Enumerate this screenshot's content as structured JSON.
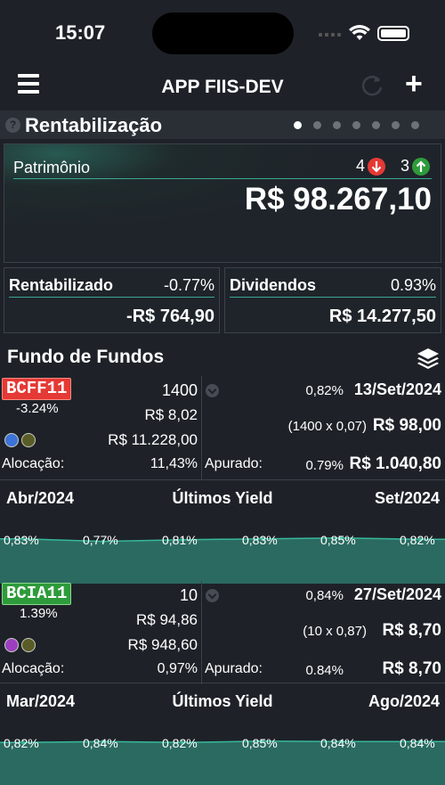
{
  "status": {
    "time": "15:07"
  },
  "nav": {
    "title": "APP FIIS-DEV",
    "menu_icon": "hamburger-menu-icon",
    "refresh_icon": "refresh-icon",
    "add_icon": "plus-icon"
  },
  "section": {
    "title": "Rentabilização",
    "pages": 7,
    "active_page": 0
  },
  "patrimonio": {
    "label": "Patrimônio",
    "down_count": "4",
    "up_count": "3",
    "value": "R$ 98.267,10"
  },
  "rentabilizado": {
    "label": "Rentabilizado",
    "pct": "-0.77%",
    "value": "-R$ 764,90"
  },
  "dividendos": {
    "label": "Dividendos",
    "pct": "0.93%",
    "value": "R$ 14.277,50"
  },
  "fof": {
    "title": "Fundo de Fundos",
    "icon": "layers-icon"
  },
  "funds": [
    {
      "ticker": "BCFF11",
      "ticker_color": "red",
      "variation": "-3.24%",
      "quantity": "1400",
      "price": "R$ 8,02",
      "total": "R$ 11.228,00",
      "dot_colors": [
        "#3d73d6",
        "#5a5c28"
      ],
      "alloc_label": "Alocação:",
      "alloc_value": "11,43%",
      "dy": "0,82%",
      "date": "13/Set/2024",
      "calc": "(1400 x 0,07)",
      "dividend": "R$ 98,00",
      "apurado_label": "Apurado:",
      "apurado_pct": "0.79%",
      "apurado_value": "R$ 1.040,80",
      "yield": {
        "from": "Abr/2024",
        "title": "Últimos Yield",
        "to": "Set/2024",
        "labels": [
          "0,83%",
          "0,77%",
          "0,81%",
          "0,83%",
          "0,85%",
          "0,82%"
        ],
        "values": [
          0.83,
          0.77,
          0.81,
          0.83,
          0.85,
          0.82
        ]
      }
    },
    {
      "ticker": "BCIA11",
      "ticker_color": "green",
      "variation": "1.39%",
      "quantity": "10",
      "price": "R$ 94,86",
      "total": "R$ 948,60",
      "dot_colors": [
        "#9b3fbf",
        "#5a5c28"
      ],
      "alloc_label": "Alocação:",
      "alloc_value": "0,97%",
      "dy": "0,84%",
      "date": "27/Set/2024",
      "calc": "(10 x 0,87)",
      "dividend": "R$ 8,70",
      "apurado_label": "Apurado:",
      "apurado_pct": "0.84%",
      "apurado_value": "R$ 8,70",
      "yield": {
        "from": "Mar/2024",
        "title": "Últimos Yield",
        "to": "Ago/2024",
        "labels": [
          "0,82%",
          "0,84%",
          "0,82%",
          "0,85%",
          "0,84%",
          "0,84%"
        ],
        "values": [
          0.82,
          0.84,
          0.82,
          0.85,
          0.84,
          0.84
        ]
      }
    }
  ]
}
